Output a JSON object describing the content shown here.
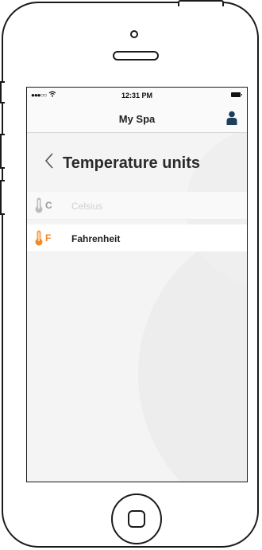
{
  "status_bar": {
    "signal": "●●●○○",
    "time": "12:31 PM"
  },
  "nav": {
    "title": "My Spa",
    "profile_icon": "person-icon"
  },
  "page": {
    "title": "Temperature units",
    "back_icon": "chevron-left-icon"
  },
  "units": [
    {
      "letter": "C",
      "label": "Celsius",
      "selected": false,
      "color": "#9a9a9a"
    },
    {
      "letter": "F",
      "label": "Fahrenheit",
      "selected": true,
      "color": "#f08a2c"
    }
  ]
}
